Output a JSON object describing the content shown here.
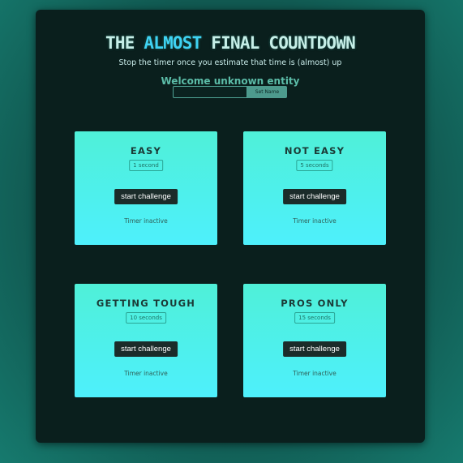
{
  "header": {
    "title_before": "THE ",
    "title_accent": "ALMOST",
    "title_after": " FINAL COUNTDOWN",
    "subtitle": "Stop the timer once you estimate that time is (almost) up",
    "welcome": "Welcome unknown entity"
  },
  "name_form": {
    "input_value": "",
    "input_placeholder": "",
    "button_label": "Set Name"
  },
  "challenges": [
    {
      "title": "EASY",
      "duration": "1 second",
      "button_label": "start challenge",
      "status": "Timer inactive"
    },
    {
      "title": "NOT EASY",
      "duration": "5 seconds",
      "button_label": "start challenge",
      "status": "Timer inactive"
    },
    {
      "title": "GETTING TOUGH",
      "duration": "10 seconds",
      "button_label": "start challenge",
      "status": "Timer inactive"
    },
    {
      "title": "PROS ONLY",
      "duration": "15 seconds",
      "button_label": "start challenge",
      "status": "Timer inactive"
    }
  ],
  "colors": {
    "page_background": "#115a52",
    "panel_background": "#0a1f1d",
    "accent": "#3fd3f3",
    "card_gradient_top": "#4ff0d8",
    "card_gradient_bottom": "#4ef0fc",
    "button_background": "#1b2c2a"
  }
}
